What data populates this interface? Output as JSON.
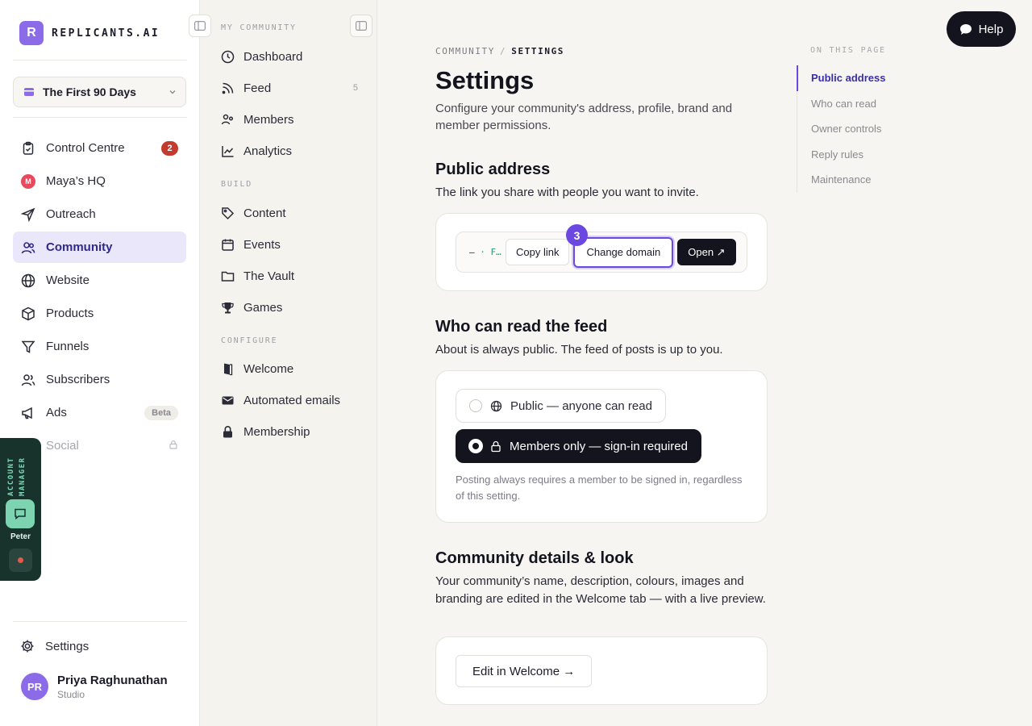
{
  "brand": {
    "logo_letter": "R",
    "name": "REPLICANTS.AI"
  },
  "workspace": {
    "label": "The First 90 Days"
  },
  "nav": {
    "items": [
      {
        "label": "Control Centre",
        "icon": "clipboard-icon",
        "badge": "2"
      },
      {
        "label": "Maya’s HQ",
        "icon": "maya-avatar-icon",
        "avatar_letter": "M"
      },
      {
        "label": "Outreach",
        "icon": "send-icon"
      },
      {
        "label": "Community",
        "icon": "users-icon",
        "active": true
      },
      {
        "label": "Website",
        "icon": "globe-icon"
      },
      {
        "label": "Products",
        "icon": "box-icon"
      },
      {
        "label": "Funnels",
        "icon": "funnel-icon"
      },
      {
        "label": "Subscribers",
        "icon": "user-group-icon"
      },
      {
        "label": "Ads",
        "icon": "megaphone-icon",
        "badge": "Beta"
      },
      {
        "label": "Social",
        "icon": "share-icon",
        "locked": true
      }
    ],
    "settings_label": "Settings"
  },
  "user": {
    "initials": "PR",
    "name": "Priya Raghunathan",
    "plan": "Studio"
  },
  "account_manager": {
    "label": "ACCOUNT MANAGER",
    "name": "Peter"
  },
  "subnav": {
    "sections": [
      {
        "title": "MY COMMUNITY",
        "items": [
          {
            "label": "Dashboard",
            "icon": "clock-icon"
          },
          {
            "label": "Feed",
            "icon": "rss-icon",
            "count": "5"
          },
          {
            "label": "Members",
            "icon": "members-icon"
          },
          {
            "label": "Analytics",
            "icon": "chart-icon"
          }
        ]
      },
      {
        "title": "BUILD",
        "items": [
          {
            "label": "Content",
            "icon": "tag-icon"
          },
          {
            "label": "Events",
            "icon": "calendar-icon"
          },
          {
            "label": "The Vault",
            "icon": "folder-icon"
          },
          {
            "label": "Games",
            "icon": "trophy-icon"
          }
        ]
      },
      {
        "title": "CONFIGURE",
        "items": [
          {
            "label": "Welcome",
            "icon": "door-icon"
          },
          {
            "label": "Automated emails",
            "icon": "mail-icon"
          },
          {
            "label": "Membership",
            "icon": "lock-icon"
          }
        ]
      }
    ]
  },
  "main": {
    "breadcrumb": {
      "parent": "COMMUNITY",
      "separator": "/",
      "current": "SETTINGS"
    },
    "title": "Settings",
    "subtitle": "Configure your community's address, profile, brand and member permissions.",
    "public_address": {
      "title": "Public address",
      "description": "The link you share with people you want to invite.",
      "url_prefix": "—",
      "url_dot": "·",
      "url_text": "F…",
      "copy_label": "Copy link",
      "change_label": "Change domain",
      "open_label": "Open ↗",
      "step_badge": "3"
    },
    "feed_access": {
      "title": "Who can read the feed",
      "description": "About is always public. The feed of posts is up to you.",
      "options": [
        {
          "label": "Public — anyone can read",
          "icon": "globe-icon",
          "selected": false
        },
        {
          "label": "Members only — sign-in required",
          "icon": "lock-icon",
          "selected": true
        }
      ],
      "note": "Posting always requires a member to be signed in, regardless of this setting."
    },
    "details": {
      "title": "Community details & look",
      "description": "Your community’s name, description, colours, images and branding are edited in the Welcome tab — with a live preview.",
      "button_label": "Edit in Welcome →"
    }
  },
  "toc": {
    "title": "ON THIS PAGE",
    "items": [
      "Public address",
      "Who can read",
      "Owner controls",
      "Reply rules",
      "Maintenance"
    ],
    "active_index": 0
  },
  "help": {
    "label": "Help"
  },
  "colors": {
    "accent": "#6b48e0",
    "brand": "#8b6be8",
    "dark": "#14141f",
    "badge_red": "#c33b2f",
    "manager_bg": "#17332c"
  }
}
